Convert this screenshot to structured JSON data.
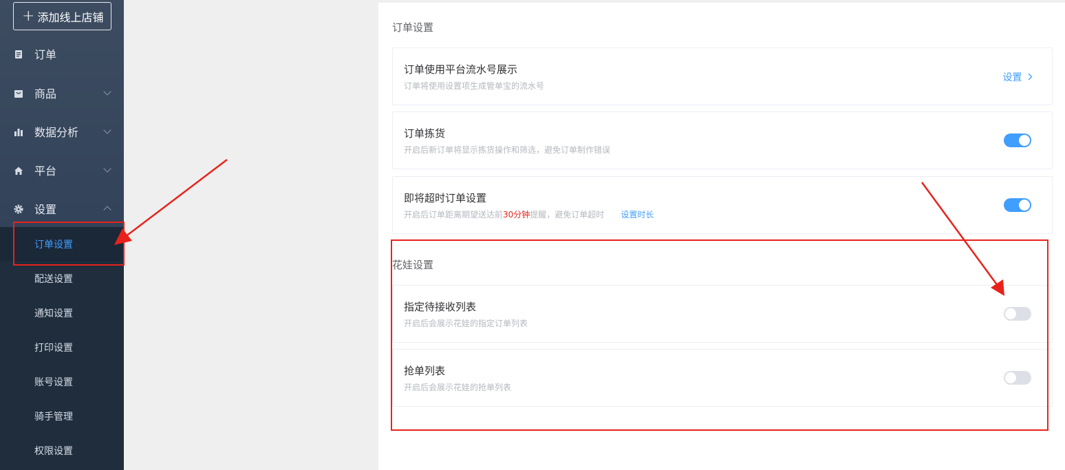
{
  "sidebar": {
    "add_store_label": "添加线上店铺",
    "items": [
      {
        "label": "订单",
        "icon": "document-icon"
      },
      {
        "label": "商品",
        "icon": "bag-icon"
      },
      {
        "label": "数据分析",
        "icon": "bar-chart-icon"
      },
      {
        "label": "平台",
        "icon": "home-icon"
      },
      {
        "label": "设置",
        "icon": "gear-icon"
      }
    ],
    "submenu": [
      {
        "label": "订单设置",
        "active": true
      },
      {
        "label": "配送设置"
      },
      {
        "label": "通知设置"
      },
      {
        "label": "打印设置"
      },
      {
        "label": "账号设置"
      },
      {
        "label": "骑手管理"
      },
      {
        "label": "权限设置"
      }
    ]
  },
  "main": {
    "order_section_title": "订单设置",
    "cards": [
      {
        "title": "订单使用平台流水号展示",
        "desc": "订单将使用设置项生成管单宝的流水号",
        "action_label": "设置"
      },
      {
        "title": "订单拣货",
        "desc": "开启后新订单将显示拣货操作和筛选，避免订单制作错误",
        "toggle": "on"
      },
      {
        "title": "即将超时订单设置",
        "desc_before": "开启后订单距离期望送达前",
        "desc_highlight": "30分钟",
        "desc_after": "提醒，避免订单超时",
        "link_label": "设置时长",
        "toggle": "on"
      }
    ],
    "huawa_section_title": "花娃设置",
    "huawa_cards": [
      {
        "title": "指定待接收列表",
        "desc": "开启后会展示花娃的指定订单列表",
        "toggle": "off"
      },
      {
        "title": "抢单列表",
        "desc": "开启后会展示花娃的抢单列表",
        "toggle": "off"
      }
    ]
  },
  "colors": {
    "accent": "#409eff",
    "annotation_red": "#e8221b",
    "sidebar_bg": "#33435a",
    "submenu_bg": "#1f2d3d"
  }
}
